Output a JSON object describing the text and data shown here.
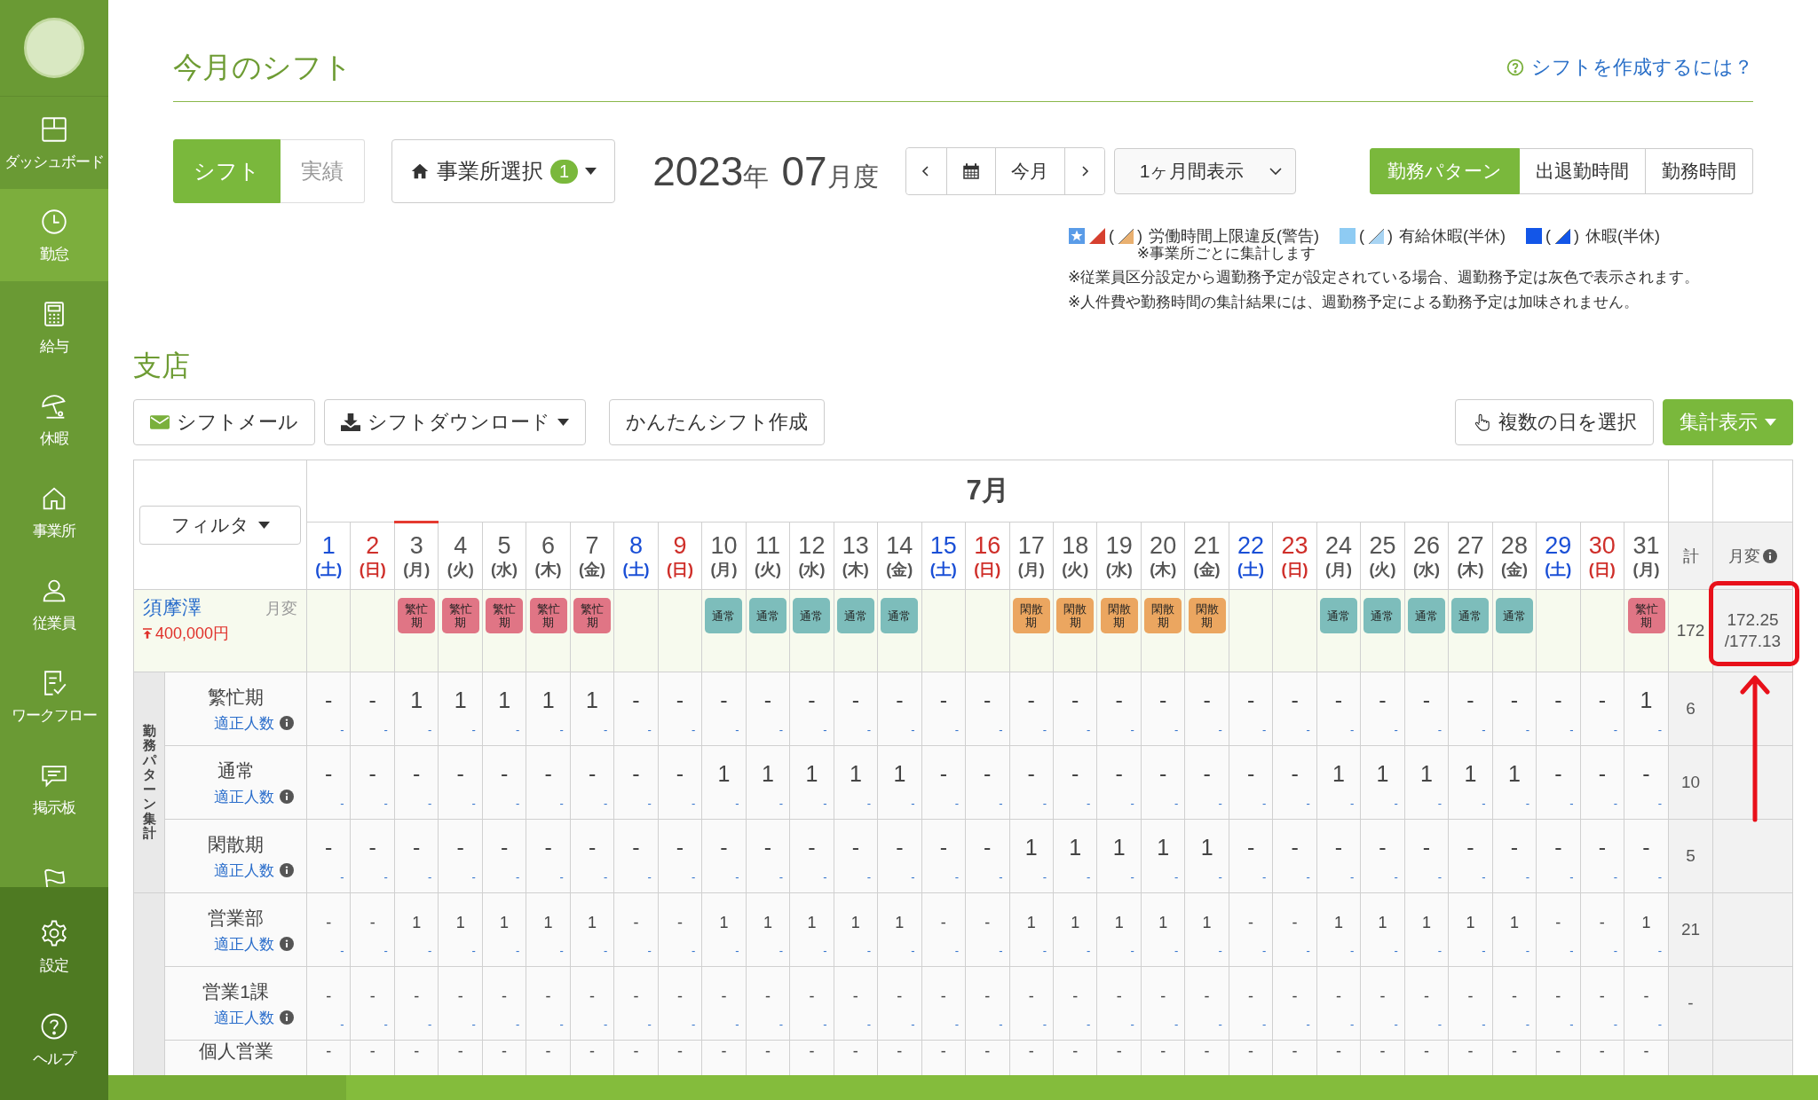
{
  "sidebar": {
    "items": [
      {
        "label": "ダッシュボード",
        "selected": false
      },
      {
        "label": "勤怠",
        "selected": true
      },
      {
        "label": "給与",
        "selected": false
      },
      {
        "label": "休暇",
        "selected": false
      },
      {
        "label": "事業所",
        "selected": false
      },
      {
        "label": "従業員",
        "selected": false
      },
      {
        "label": "ワークフロー",
        "selected": false
      },
      {
        "label": "掲示板",
        "selected": false
      },
      {
        "selected": false
      }
    ],
    "bottom_items": [
      {
        "label": "設定",
        "selected": false
      },
      {
        "label": "ヘルプ",
        "selected": false
      }
    ]
  },
  "page": {
    "title": "今月のシフト",
    "help_link": "シフトを作成するには？"
  },
  "mode_tabs": [
    {
      "label": "シフト",
      "selected": true
    },
    {
      "label": "実績",
      "selected": false
    }
  ],
  "office_select": {
    "label": "事業所選択",
    "count": "1"
  },
  "period": {
    "year": "2023",
    "year_unit": "年",
    "month": "07",
    "month_unit": "月度"
  },
  "nav": {
    "today": "今月"
  },
  "range_select": {
    "value": "1ヶ月間表示"
  },
  "view_toggle": [
    {
      "label": "勤務パターン",
      "selected": true
    },
    {
      "label": "出退勤時間",
      "selected": false
    },
    {
      "label": "勤務時間",
      "selected": false
    }
  ],
  "legend": {
    "items": [
      {
        "open": "(",
        "close": ")",
        "label": "労働時間上限違反(警告)",
        "note": "※事業所ごとに集計します"
      },
      {
        "open": "(",
        "close": ")",
        "label": "有給休暇(半休)"
      },
      {
        "open": "(",
        "close": ")",
        "label": "休暇(半休)"
      }
    ],
    "notes": [
      "※従業員区分設定から週勤務予定が設定されている場合、週勤務予定は灰色で表示されます。",
      "※人件費や勤務時間の集計結果には、週勤務予定による勤務予定は加味されません。"
    ]
  },
  "section_title": "支店",
  "toolbar": {
    "left": [
      {
        "label": "シフトメール",
        "kind": "mail"
      },
      {
        "label": "シフトダウンロード",
        "kind": "download"
      },
      {
        "label": "かんたんシフト作成",
        "kind": "plain"
      }
    ],
    "right": [
      {
        "label": "複数の日を選択",
        "kind": "select"
      },
      {
        "label": "集計表示",
        "kind": "primary"
      }
    ]
  },
  "table": {
    "filter": "フィルタ",
    "month": "7月",
    "total_header": "計",
    "monthly_header": "月変",
    "days": [
      {
        "day": "1",
        "weekday": "(土)",
        "kind": "sat",
        "today": false
      },
      {
        "day": "2",
        "weekday": "(日)",
        "kind": "sun",
        "today": false
      },
      {
        "day": "3",
        "weekday": "(月)",
        "kind": "weekday",
        "today": true,
        "shift": {
          "label": "繁忙期",
          "color": "#e07585"
        }
      },
      {
        "day": "4",
        "weekday": "(火)",
        "kind": "weekday",
        "today": false,
        "shift": {
          "label": "繁忙期",
          "color": "#e07585"
        }
      },
      {
        "day": "5",
        "weekday": "(水)",
        "kind": "weekday",
        "today": false,
        "shift": {
          "label": "繁忙期",
          "color": "#e07585"
        }
      },
      {
        "day": "6",
        "weekday": "(木)",
        "kind": "weekday",
        "today": false,
        "shift": {
          "label": "繁忙期",
          "color": "#e07585"
        }
      },
      {
        "day": "7",
        "weekday": "(金)",
        "kind": "weekday",
        "today": false,
        "shift": {
          "label": "繁忙期",
          "color": "#e07585"
        }
      },
      {
        "day": "8",
        "weekday": "(土)",
        "kind": "sat",
        "today": false
      },
      {
        "day": "9",
        "weekday": "(日)",
        "kind": "sun",
        "today": false
      },
      {
        "day": "10",
        "weekday": "(月)",
        "kind": "weekday",
        "today": false,
        "shift": {
          "label": "通常",
          "color": "#7dbdbb"
        }
      },
      {
        "day": "11",
        "weekday": "(火)",
        "kind": "weekday",
        "today": false,
        "shift": {
          "label": "通常",
          "color": "#7dbdbb"
        }
      },
      {
        "day": "12",
        "weekday": "(水)",
        "kind": "weekday",
        "today": false,
        "shift": {
          "label": "通常",
          "color": "#7dbdbb"
        }
      },
      {
        "day": "13",
        "weekday": "(木)",
        "kind": "weekday",
        "today": false,
        "shift": {
          "label": "通常",
          "color": "#7dbdbb"
        }
      },
      {
        "day": "14",
        "weekday": "(金)",
        "kind": "weekday",
        "today": false,
        "shift": {
          "label": "通常",
          "color": "#7dbdbb"
        }
      },
      {
        "day": "15",
        "weekday": "(土)",
        "kind": "sat",
        "today": false
      },
      {
        "day": "16",
        "weekday": "(日)",
        "kind": "sun",
        "today": false
      },
      {
        "day": "17",
        "weekday": "(月)",
        "kind": "weekday",
        "today": false,
        "shift": {
          "label": "閑散期",
          "color": "#eba660"
        }
      },
      {
        "day": "18",
        "weekday": "(火)",
        "kind": "weekday",
        "today": false,
        "shift": {
          "label": "閑散期",
          "color": "#eba660"
        }
      },
      {
        "day": "19",
        "weekday": "(水)",
        "kind": "weekday",
        "today": false,
        "shift": {
          "label": "閑散期",
          "color": "#eba660"
        }
      },
      {
        "day": "20",
        "weekday": "(木)",
        "kind": "weekday",
        "today": false,
        "shift": {
          "label": "閑散期",
          "color": "#eba660"
        }
      },
      {
        "day": "21",
        "weekday": "(金)",
        "kind": "weekday",
        "today": false,
        "shift": {
          "label": "閑散期",
          "color": "#eba660"
        }
      },
      {
        "day": "22",
        "weekday": "(土)",
        "kind": "sat",
        "today": false
      },
      {
        "day": "23",
        "weekday": "(日)",
        "kind": "sun",
        "today": false
      },
      {
        "day": "24",
        "weekday": "(月)",
        "kind": "weekday",
        "today": false,
        "shift": {
          "label": "通常",
          "color": "#7dbdbb"
        }
      },
      {
        "day": "25",
        "weekday": "(火)",
        "kind": "weekday",
        "today": false,
        "shift": {
          "label": "通常",
          "color": "#7dbdbb"
        }
      },
      {
        "day": "26",
        "weekday": "(水)",
        "kind": "weekday",
        "today": false,
        "shift": {
          "label": "通常",
          "color": "#7dbdbb"
        }
      },
      {
        "day": "27",
        "weekday": "(木)",
        "kind": "weekday",
        "today": false,
        "shift": {
          "label": "通常",
          "color": "#7dbdbb"
        }
      },
      {
        "day": "28",
        "weekday": "(金)",
        "kind": "weekday",
        "today": false,
        "shift": {
          "label": "通常",
          "color": "#7dbdbb"
        }
      },
      {
        "day": "29",
        "weekday": "(土)",
        "kind": "sat",
        "today": false
      },
      {
        "day": "30",
        "weekday": "(日)",
        "kind": "sun",
        "today": false
      },
      {
        "day": "31",
        "weekday": "(月)",
        "kind": "weekday",
        "today": false,
        "shift": {
          "label": "繁忙期",
          "color": "#e07585"
        }
      }
    ],
    "employee": {
      "name": "須摩澤",
      "tag": "月変",
      "salary": "400,000円",
      "total": "172",
      "monthly": "172.25\n/177.13"
    },
    "groups": [
      {
        "kind": "pattern",
        "label": "勤務パターン集計",
        "rows": [
          {
            "name": "繁忙期",
            "sub": "適正人数",
            "total": "6",
            "values": [
              "-",
              "-",
              "1",
              "1",
              "1",
              "1",
              "1",
              "-",
              "-",
              "-",
              "-",
              "-",
              "-",
              "-",
              "-",
              "-",
              "-",
              "-",
              "-",
              "-",
              "-",
              "-",
              "-",
              "-",
              "-",
              "-",
              "-",
              "-",
              "-",
              "-",
              "1"
            ],
            "targets": [
              "-",
              "-",
              "-",
              "-",
              "-",
              "-",
              "-",
              "-",
              "-",
              "-",
              "-",
              "-",
              "-",
              "-",
              "-",
              "-",
              "-",
              "-",
              "-",
              "-",
              "-",
              "-",
              "-",
              "-",
              "-",
              "-",
              "-",
              "-",
              "-",
              "-",
              "-"
            ]
          },
          {
            "name": "通常",
            "sub": "適正人数",
            "total": "10",
            "values": [
              "-",
              "-",
              "-",
              "-",
              "-",
              "-",
              "-",
              "-",
              "-",
              "1",
              "1",
              "1",
              "1",
              "1",
              "-",
              "-",
              "-",
              "-",
              "-",
              "-",
              "-",
              "-",
              "-",
              "1",
              "1",
              "1",
              "1",
              "1",
              "-",
              "-",
              "-"
            ],
            "targets": [
              "-",
              "-",
              "-",
              "-",
              "-",
              "-",
              "-",
              "-",
              "-",
              "-",
              "-",
              "-",
              "-",
              "-",
              "-",
              "-",
              "-",
              "-",
              "-",
              "-",
              "-",
              "-",
              "-",
              "-",
              "-",
              "-",
              "-",
              "-",
              "-",
              "-",
              "-"
            ]
          },
          {
            "name": "閑散期",
            "sub": "適正人数",
            "total": "5",
            "values": [
              "-",
              "-",
              "-",
              "-",
              "-",
              "-",
              "-",
              "-",
              "-",
              "-",
              "-",
              "-",
              "-",
              "-",
              "-",
              "-",
              "1",
              "1",
              "1",
              "1",
              "1",
              "-",
              "-",
              "-",
              "-",
              "-",
              "-",
              "-",
              "-",
              "-",
              "-"
            ],
            "targets": [
              "-",
              "-",
              "-",
              "-",
              "-",
              "-",
              "-",
              "-",
              "-",
              "-",
              "-",
              "-",
              "-",
              "-",
              "-",
              "-",
              "-",
              "-",
              "-",
              "-",
              "-",
              "-",
              "-",
              "-",
              "-",
              "-",
              "-",
              "-",
              "-",
              "-",
              "-"
            ]
          }
        ]
      },
      {
        "kind": "department",
        "rows": [
          {
            "name": "営業部",
            "sub": "適正人数",
            "total": "21",
            "values": [
              "-",
              "-",
              "1",
              "1",
              "1",
              "1",
              "1",
              "-",
              "-",
              "1",
              "1",
              "1",
              "1",
              "1",
              "-",
              "-",
              "1",
              "1",
              "1",
              "1",
              "1",
              "-",
              "-",
              "1",
              "1",
              "1",
              "1",
              "1",
              "-",
              "-",
              "1"
            ],
            "targets": [
              "-",
              "-",
              "-",
              "-",
              "-",
              "-",
              "-",
              "-",
              "-",
              "-",
              "-",
              "-",
              "-",
              "-",
              "-",
              "-",
              "-",
              "-",
              "-",
              "-",
              "-",
              "-",
              "-",
              "-",
              "-",
              "-",
              "-",
              "-",
              "-",
              "-",
              "-"
            ]
          },
          {
            "name": "営業1課",
            "sub": "適正人数",
            "total": "-",
            "values": [
              "-",
              "-",
              "-",
              "-",
              "-",
              "-",
              "-",
              "-",
              "-",
              "-",
              "-",
              "-",
              "-",
              "-",
              "-",
              "-",
              "-",
              "-",
              "-",
              "-",
              "-",
              "-",
              "-",
              "-",
              "-",
              "-",
              "-",
              "-",
              "-",
              "-",
              "-"
            ],
            "targets": [
              "-",
              "-",
              "-",
              "-",
              "-",
              "-",
              "-",
              "-",
              "-",
              "-",
              "-",
              "-",
              "-",
              "-",
              "-",
              "-",
              "-",
              "-",
              "-",
              "-",
              "-",
              "-",
              "-",
              "-",
              "-",
              "-",
              "-",
              "-",
              "-",
              "-",
              "-"
            ]
          },
          {
            "name": "個人営業",
            "values": [
              "-",
              "-",
              "-",
              "-",
              "-",
              "-",
              "-",
              "-",
              "-",
              "-",
              "-",
              "-",
              "-",
              "-",
              "-",
              "-",
              "-",
              "-",
              "-",
              "-",
              "-",
              "-",
              "-",
              "-",
              "-",
              "-",
              "-",
              "-",
              "-",
              "-",
              "-"
            ]
          }
        ]
      }
    ]
  }
}
